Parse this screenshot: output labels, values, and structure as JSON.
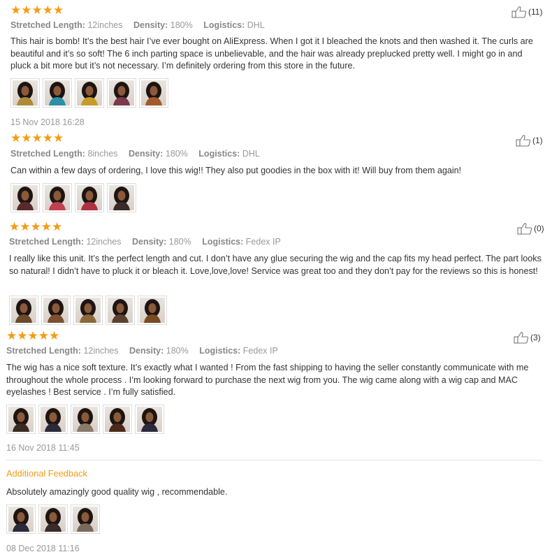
{
  "reviews": [
    {
      "stars": "★★★★★",
      "stretched_length_label": "Stretched Length:",
      "stretched_length": "12inches",
      "density_label": "Density:",
      "density": "180%",
      "logistics_label": "Logistics:",
      "logistics": "DHL",
      "likes": "(11)",
      "text": "This hair is bomb! It’s the best hair I’ve ever bought on AliExpress. When I got it I bleached the knots and then washed it. The curls are beautiful and it’s so soft! The 6 inch parting space is unbelievable, and the hair was already preplucked pretty well. I might go in and pluck a bit more but it’s not necessary. I’m definitely ordering from this store in the future.",
      "photos": 5,
      "photo_colors": [
        "#b08a3a",
        "#2b8fa8",
        "#c79a2a",
        "#7a3a4a",
        "#a35a2a"
      ],
      "date": "15 Nov 2018 16:28"
    },
    {
      "stars": "★★★★★",
      "stretched_length_label": "Stretched Length:",
      "stretched_length": "8inches",
      "density_label": "Density:",
      "density": "180%",
      "logistics_label": "Logistics:",
      "logistics": "DHL",
      "likes": "(1)",
      "text": "Can within a few days of ordering, I love this wig!! They also put goodies in the box with it! Will buy from them again!",
      "photos": 4,
      "photo_colors": [
        "#5a2a2a",
        "#c04050",
        "#b03040",
        "#3a2a2a"
      ]
    },
    {
      "stars": "★★★★★",
      "stretched_length_label": "Stretched Length:",
      "stretched_length": "12inches",
      "density_label": "Density:",
      "density": "180%",
      "logistics_label": "Logistics:",
      "logistics": "Fedex IP",
      "likes": "(0)",
      "text": "I really like this unit. It’s the perfect length and cut. I don’t have any glue securing the wig and the cap fits my head perfect. The part looks so natural! I didn’t have to pluck it or bleach it. Love,love,love! Service was great too and they don’t pay for the reviews so this is honest!",
      "photos": 5,
      "photo_colors": [
        "#6a4a2a",
        "#7a5030",
        "#8a6a3a",
        "#5a4030",
        "#7a4a20"
      ]
    },
    {
      "stars": "★★★★★",
      "stretched_length_label": "Stretched Length:",
      "stretched_length": "12inches",
      "density_label": "Density:",
      "density": "180%",
      "logistics_label": "Logistics:",
      "logistics": "Fedex IP",
      "likes": "(3)",
      "text": "The wig has a nice soft texture. It’s exactly what I wanted ! From the fast shipping to having the seller constantly communicate with me throughout the whole process . I’m looking forward to purchase the next wig from you. The wig came along with a wig cap and MAC eyelashes ! Best service . I’m fully satisfied.",
      "photos": 5,
      "photo_colors": [
        "#3a2a22",
        "#2a2a3a",
        "#8a7a6a",
        "#4a2a1a",
        "#2a2a3a"
      ],
      "date": "16 Nov 2018 11:45"
    }
  ],
  "additional": {
    "title": "Additional Feedback",
    "text": "Absolutely amazingly good quality wig , recommendable.",
    "photos": 3,
    "photo_colors": [
      "#2a2a3a",
      "#3a2a2a",
      "#7a6a5a"
    ],
    "date": "08 Dec 2018 11:16"
  },
  "colors": {
    "star": "#f39c12",
    "accent": "#f39c12"
  }
}
